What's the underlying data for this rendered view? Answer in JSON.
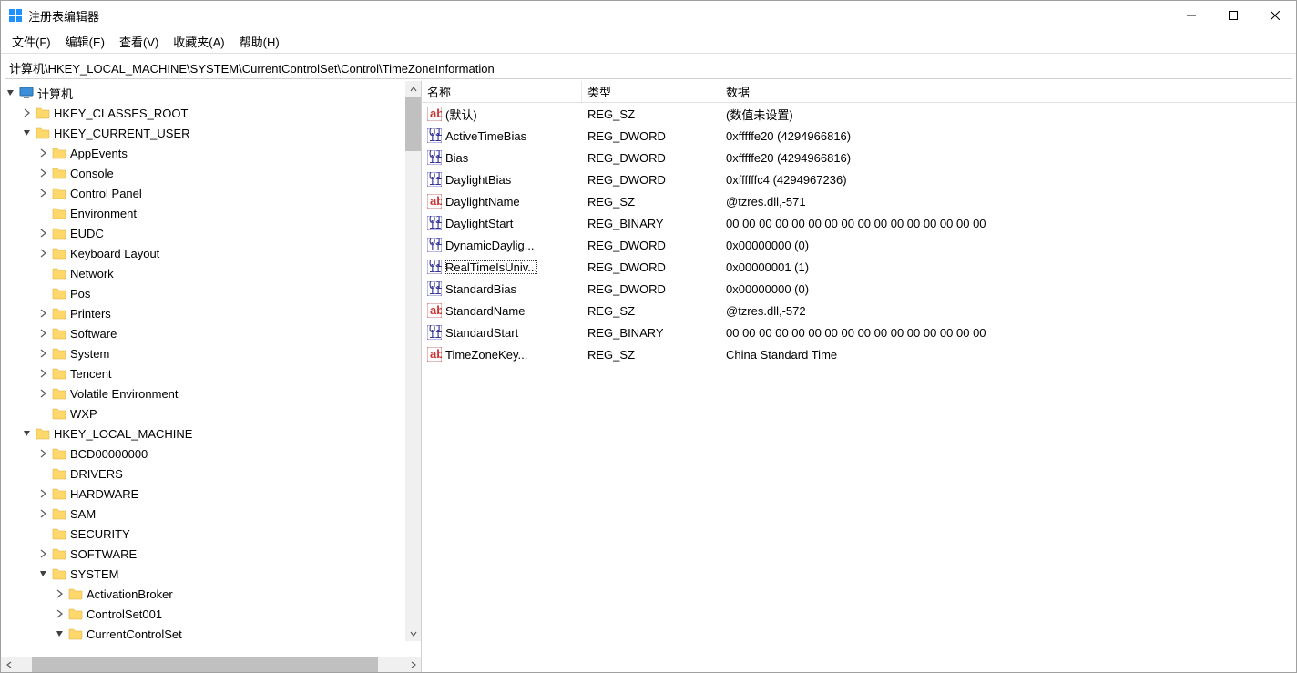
{
  "window": {
    "title": "注册表编辑器"
  },
  "menubar": {
    "file": "文件(F)",
    "edit": "编辑(E)",
    "view": "查看(V)",
    "favorites": "收藏夹(A)",
    "help": "帮助(H)"
  },
  "addressbar": {
    "path": "计算机\\HKEY_LOCAL_MACHINE\\SYSTEM\\CurrentControlSet\\Control\\TimeZoneInformation"
  },
  "tree": {
    "root": "计算机",
    "nodes": [
      {
        "label": "HKEY_CLASSES_ROOT",
        "depth": 1,
        "expander": "closed"
      },
      {
        "label": "HKEY_CURRENT_USER",
        "depth": 1,
        "expander": "open"
      },
      {
        "label": "AppEvents",
        "depth": 2,
        "expander": "closed"
      },
      {
        "label": "Console",
        "depth": 2,
        "expander": "closed"
      },
      {
        "label": "Control Panel",
        "depth": 2,
        "expander": "closed"
      },
      {
        "label": "Environment",
        "depth": 2,
        "expander": "none"
      },
      {
        "label": "EUDC",
        "depth": 2,
        "expander": "closed"
      },
      {
        "label": "Keyboard Layout",
        "depth": 2,
        "expander": "closed"
      },
      {
        "label": "Network",
        "depth": 2,
        "expander": "none"
      },
      {
        "label": "Pos",
        "depth": 2,
        "expander": "none"
      },
      {
        "label": "Printers",
        "depth": 2,
        "expander": "closed"
      },
      {
        "label": "Software",
        "depth": 2,
        "expander": "closed"
      },
      {
        "label": "System",
        "depth": 2,
        "expander": "closed"
      },
      {
        "label": "Tencent",
        "depth": 2,
        "expander": "closed"
      },
      {
        "label": "Volatile Environment",
        "depth": 2,
        "expander": "closed"
      },
      {
        "label": "WXP",
        "depth": 2,
        "expander": "none"
      },
      {
        "label": "HKEY_LOCAL_MACHINE",
        "depth": 1,
        "expander": "open"
      },
      {
        "label": "BCD00000000",
        "depth": 2,
        "expander": "closed"
      },
      {
        "label": "DRIVERS",
        "depth": 2,
        "expander": "none"
      },
      {
        "label": "HARDWARE",
        "depth": 2,
        "expander": "closed"
      },
      {
        "label": "SAM",
        "depth": 2,
        "expander": "closed"
      },
      {
        "label": "SECURITY",
        "depth": 2,
        "expander": "none"
      },
      {
        "label": "SOFTWARE",
        "depth": 2,
        "expander": "closed"
      },
      {
        "label": "SYSTEM",
        "depth": 2,
        "expander": "open"
      },
      {
        "label": "ActivationBroker",
        "depth": 3,
        "expander": "closed"
      },
      {
        "label": "ControlSet001",
        "depth": 3,
        "expander": "closed"
      },
      {
        "label": "CurrentControlSet",
        "depth": 3,
        "expander": "open"
      }
    ]
  },
  "list": {
    "headers": {
      "name": "名称",
      "type": "类型",
      "data": "数据"
    },
    "rows": [
      {
        "icon": "sz",
        "name": "(默认)",
        "type": "REG_SZ",
        "data": "(数值未设置)",
        "selected": false
      },
      {
        "icon": "bin",
        "name": "ActiveTimeBias",
        "type": "REG_DWORD",
        "data": "0xfffffe20 (4294966816)",
        "selected": false
      },
      {
        "icon": "bin",
        "name": "Bias",
        "type": "REG_DWORD",
        "data": "0xfffffe20 (4294966816)",
        "selected": false
      },
      {
        "icon": "bin",
        "name": "DaylightBias",
        "type": "REG_DWORD",
        "data": "0xffffffc4 (4294967236)",
        "selected": false
      },
      {
        "icon": "sz",
        "name": "DaylightName",
        "type": "REG_SZ",
        "data": "@tzres.dll,-571",
        "selected": false
      },
      {
        "icon": "bin",
        "name": "DaylightStart",
        "type": "REG_BINARY",
        "data": "00 00 00 00 00 00 00 00 00 00 00 00 00 00 00 00",
        "selected": false
      },
      {
        "icon": "bin",
        "name": "DynamicDaylig...",
        "type": "REG_DWORD",
        "data": "0x00000000 (0)",
        "selected": false
      },
      {
        "icon": "bin",
        "name": "RealTimeIsUniv...",
        "type": "REG_DWORD",
        "data": "0x00000001 (1)",
        "selected": true
      },
      {
        "icon": "bin",
        "name": "StandardBias",
        "type": "REG_DWORD",
        "data": "0x00000000 (0)",
        "selected": false
      },
      {
        "icon": "sz",
        "name": "StandardName",
        "type": "REG_SZ",
        "data": "@tzres.dll,-572",
        "selected": false
      },
      {
        "icon": "bin",
        "name": "StandardStart",
        "type": "REG_BINARY",
        "data": "00 00 00 00 00 00 00 00 00 00 00 00 00 00 00 00",
        "selected": false
      },
      {
        "icon": "sz",
        "name": "TimeZoneKey...",
        "type": "REG_SZ",
        "data": "China Standard Time",
        "selected": false
      }
    ]
  }
}
